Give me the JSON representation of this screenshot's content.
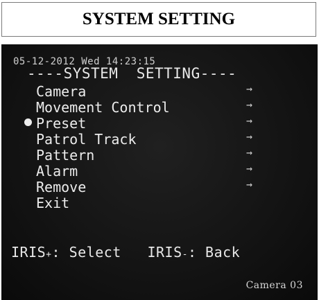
{
  "header": {
    "title": "SYSTEM SETTING"
  },
  "osd": {
    "datetime": "05-12-2012 Wed 14:23:15",
    "menu_title": "----SYSTEM  SETTING----",
    "items": [
      {
        "label": "Camera",
        "arrow": "→",
        "selected": false
      },
      {
        "label": "Movement Control",
        "arrow": "→",
        "selected": false
      },
      {
        "label": "Preset",
        "arrow": "→",
        "selected": true
      },
      {
        "label": "Patrol Track",
        "arrow": "→",
        "selected": false
      },
      {
        "label": "Pattern",
        "arrow": "→",
        "selected": false
      },
      {
        "label": "Alarm",
        "arrow": "→",
        "selected": false
      },
      {
        "label": "Remove",
        "arrow": "→",
        "selected": false
      },
      {
        "label": "Exit",
        "arrow": "",
        "selected": false
      }
    ],
    "hint": {
      "select_key": "IRIS",
      "select_sign": "+",
      "select_text": ": Select",
      "back_key": "IRIS",
      "back_sign": "-",
      "back_text": ": Back"
    },
    "camera_label": "Camera 03"
  }
}
